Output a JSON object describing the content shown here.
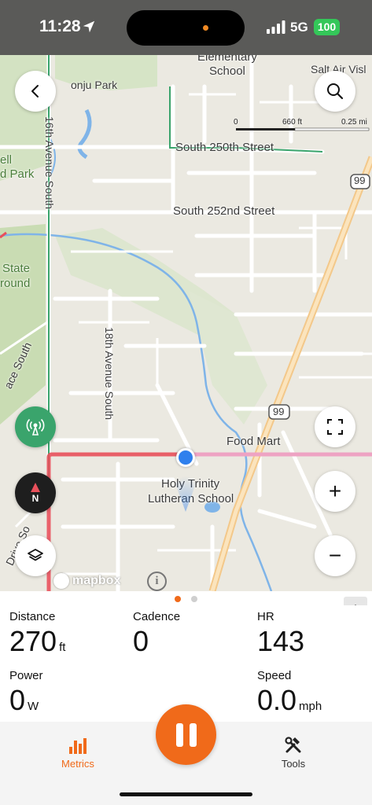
{
  "status_bar": {
    "time": "11:28",
    "network": "5G",
    "battery": "100"
  },
  "map": {
    "labels": {
      "elementary_school": "Elementary\nSchool",
      "salt_air": "Salt Air Visl",
      "park": "onju Park",
      "park_left_1": "ell",
      "park_left_2": "d Park",
      "ave_16th": "16th Avenue South",
      "ave_18th": "18th Avenue South",
      "south_250th": "South 250th Street",
      "south_252nd": "South 252nd Street",
      "state_1": "State",
      "state_2": "round",
      "ace_south": "ace South",
      "drive_so": "Drive So",
      "food_mart": "Food Mart",
      "school_1": "Holy Trinity",
      "school_2": "Lutheran School",
      "route_99_a": "99",
      "route_99_b": "99"
    },
    "scale": {
      "zero": "0",
      "mid": "660 ft",
      "end": "0.25 mi"
    },
    "attribution": "mapbox",
    "controls": {
      "back": "back-icon",
      "search": "search-icon",
      "broadcast": "broadcast-icon",
      "compass": "N",
      "layers": "layers-icon",
      "fullscreen": "fullscreen-icon",
      "zoom_in": "+",
      "zoom_out": "−"
    },
    "colors": {
      "route": "#e8505b",
      "user": "#2f80ed",
      "water": "#7fb4e8",
      "park": "#c9dcb3"
    }
  },
  "pager": {
    "pages": 2,
    "active": 0
  },
  "metrics": [
    {
      "label": "Distance",
      "value": "270",
      "unit": "ft"
    },
    {
      "label": "Cadence",
      "value": "0",
      "unit": ""
    },
    {
      "label": "HR",
      "value": "143",
      "unit": ""
    },
    {
      "label": "Power",
      "value": "0",
      "unit": "W"
    },
    {
      "label": "Speed",
      "value": "0.0",
      "unit": "mph"
    }
  ],
  "tabs": [
    {
      "label": "Metrics",
      "icon": "bar-chart-icon",
      "active": true
    },
    {
      "label": "Tools",
      "icon": "tools-icon",
      "active": false
    }
  ],
  "accent_color": "#f06a1a"
}
